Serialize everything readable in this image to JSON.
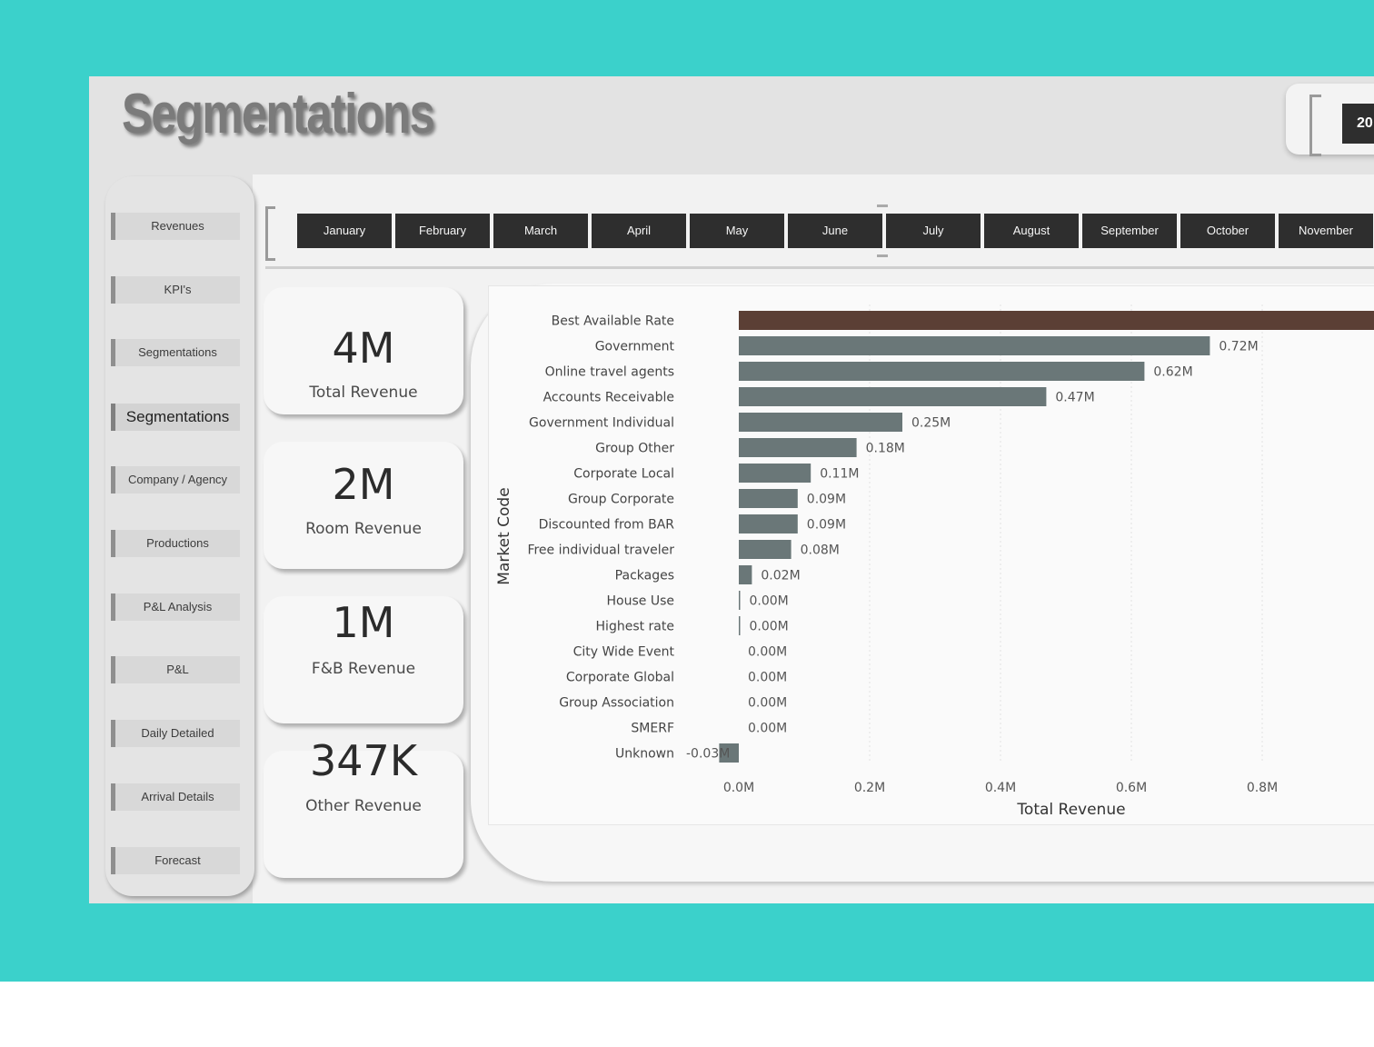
{
  "page": {
    "title": "Segmentations",
    "year_button": "20"
  },
  "sidebar": {
    "items": [
      {
        "label": "Revenues",
        "active": false
      },
      {
        "label": "KPI's",
        "active": false
      },
      {
        "label": "Segmentations",
        "active": false
      },
      {
        "label": "Segmentations",
        "active": true
      },
      {
        "label": "Company / Agency",
        "active": false
      },
      {
        "label": "Productions",
        "active": false
      },
      {
        "label": "P&L Analysis",
        "active": false
      },
      {
        "label": "P&L",
        "active": false
      },
      {
        "label": "Daily Detailed",
        "active": false
      },
      {
        "label": "Arrival Details",
        "active": false
      },
      {
        "label": "Forecast",
        "active": false
      }
    ]
  },
  "months": [
    "January",
    "February",
    "March",
    "April",
    "May",
    "June",
    "July",
    "August",
    "September",
    "October",
    "November"
  ],
  "kpis": [
    {
      "value": "4M",
      "label": "Total Revenue"
    },
    {
      "value": "2M",
      "label": "Room Revenue"
    },
    {
      "value": "1M",
      "label": "F&B Revenue"
    },
    {
      "value": "347K",
      "label": "Other Revenue"
    }
  ],
  "colors": {
    "background": "#3bd1cb",
    "highlight_bar": "#5b3f35",
    "bar": "#6a7778",
    "button_dark": "#2e2e2e"
  },
  "chart_data": {
    "type": "bar",
    "orientation": "horizontal",
    "xlabel": "Total Revenue",
    "ylabel": "Market Code",
    "x_ticks": [
      "0.0M",
      "0.2M",
      "0.4M",
      "0.6M",
      "0.8M"
    ],
    "xlim_visible": [
      -0.03,
      0.97
    ],
    "categories": [
      "Best Available Rate",
      "Government",
      "Online travel agents",
      "Accounts Receivable",
      "Government Individual",
      "Group Other",
      "Corporate Local",
      "Group Corporate",
      "Discounted from BAR",
      "Free individual traveler",
      "Packages",
      "House Use",
      "Highest rate",
      "City Wide Event",
      "Corporate Global",
      "Group Association",
      "SMERF",
      "Unknown"
    ],
    "values": [
      1.0,
      0.72,
      0.62,
      0.47,
      0.25,
      0.18,
      0.11,
      0.09,
      0.09,
      0.08,
      0.02,
      0.0,
      0.0,
      0.0,
      0.0,
      0.0,
      0.0,
      -0.03
    ],
    "data_labels": [
      "",
      "0.72M",
      "0.62M",
      "0.47M",
      "0.25M",
      "0.18M",
      "0.11M",
      "0.09M",
      "0.09M",
      "0.08M",
      "0.02M",
      "0.00M",
      "0.00M",
      "0.00M",
      "0.00M",
      "0.00M",
      "0.00M",
      "-0.03M"
    ],
    "highlighted_index": 0
  }
}
